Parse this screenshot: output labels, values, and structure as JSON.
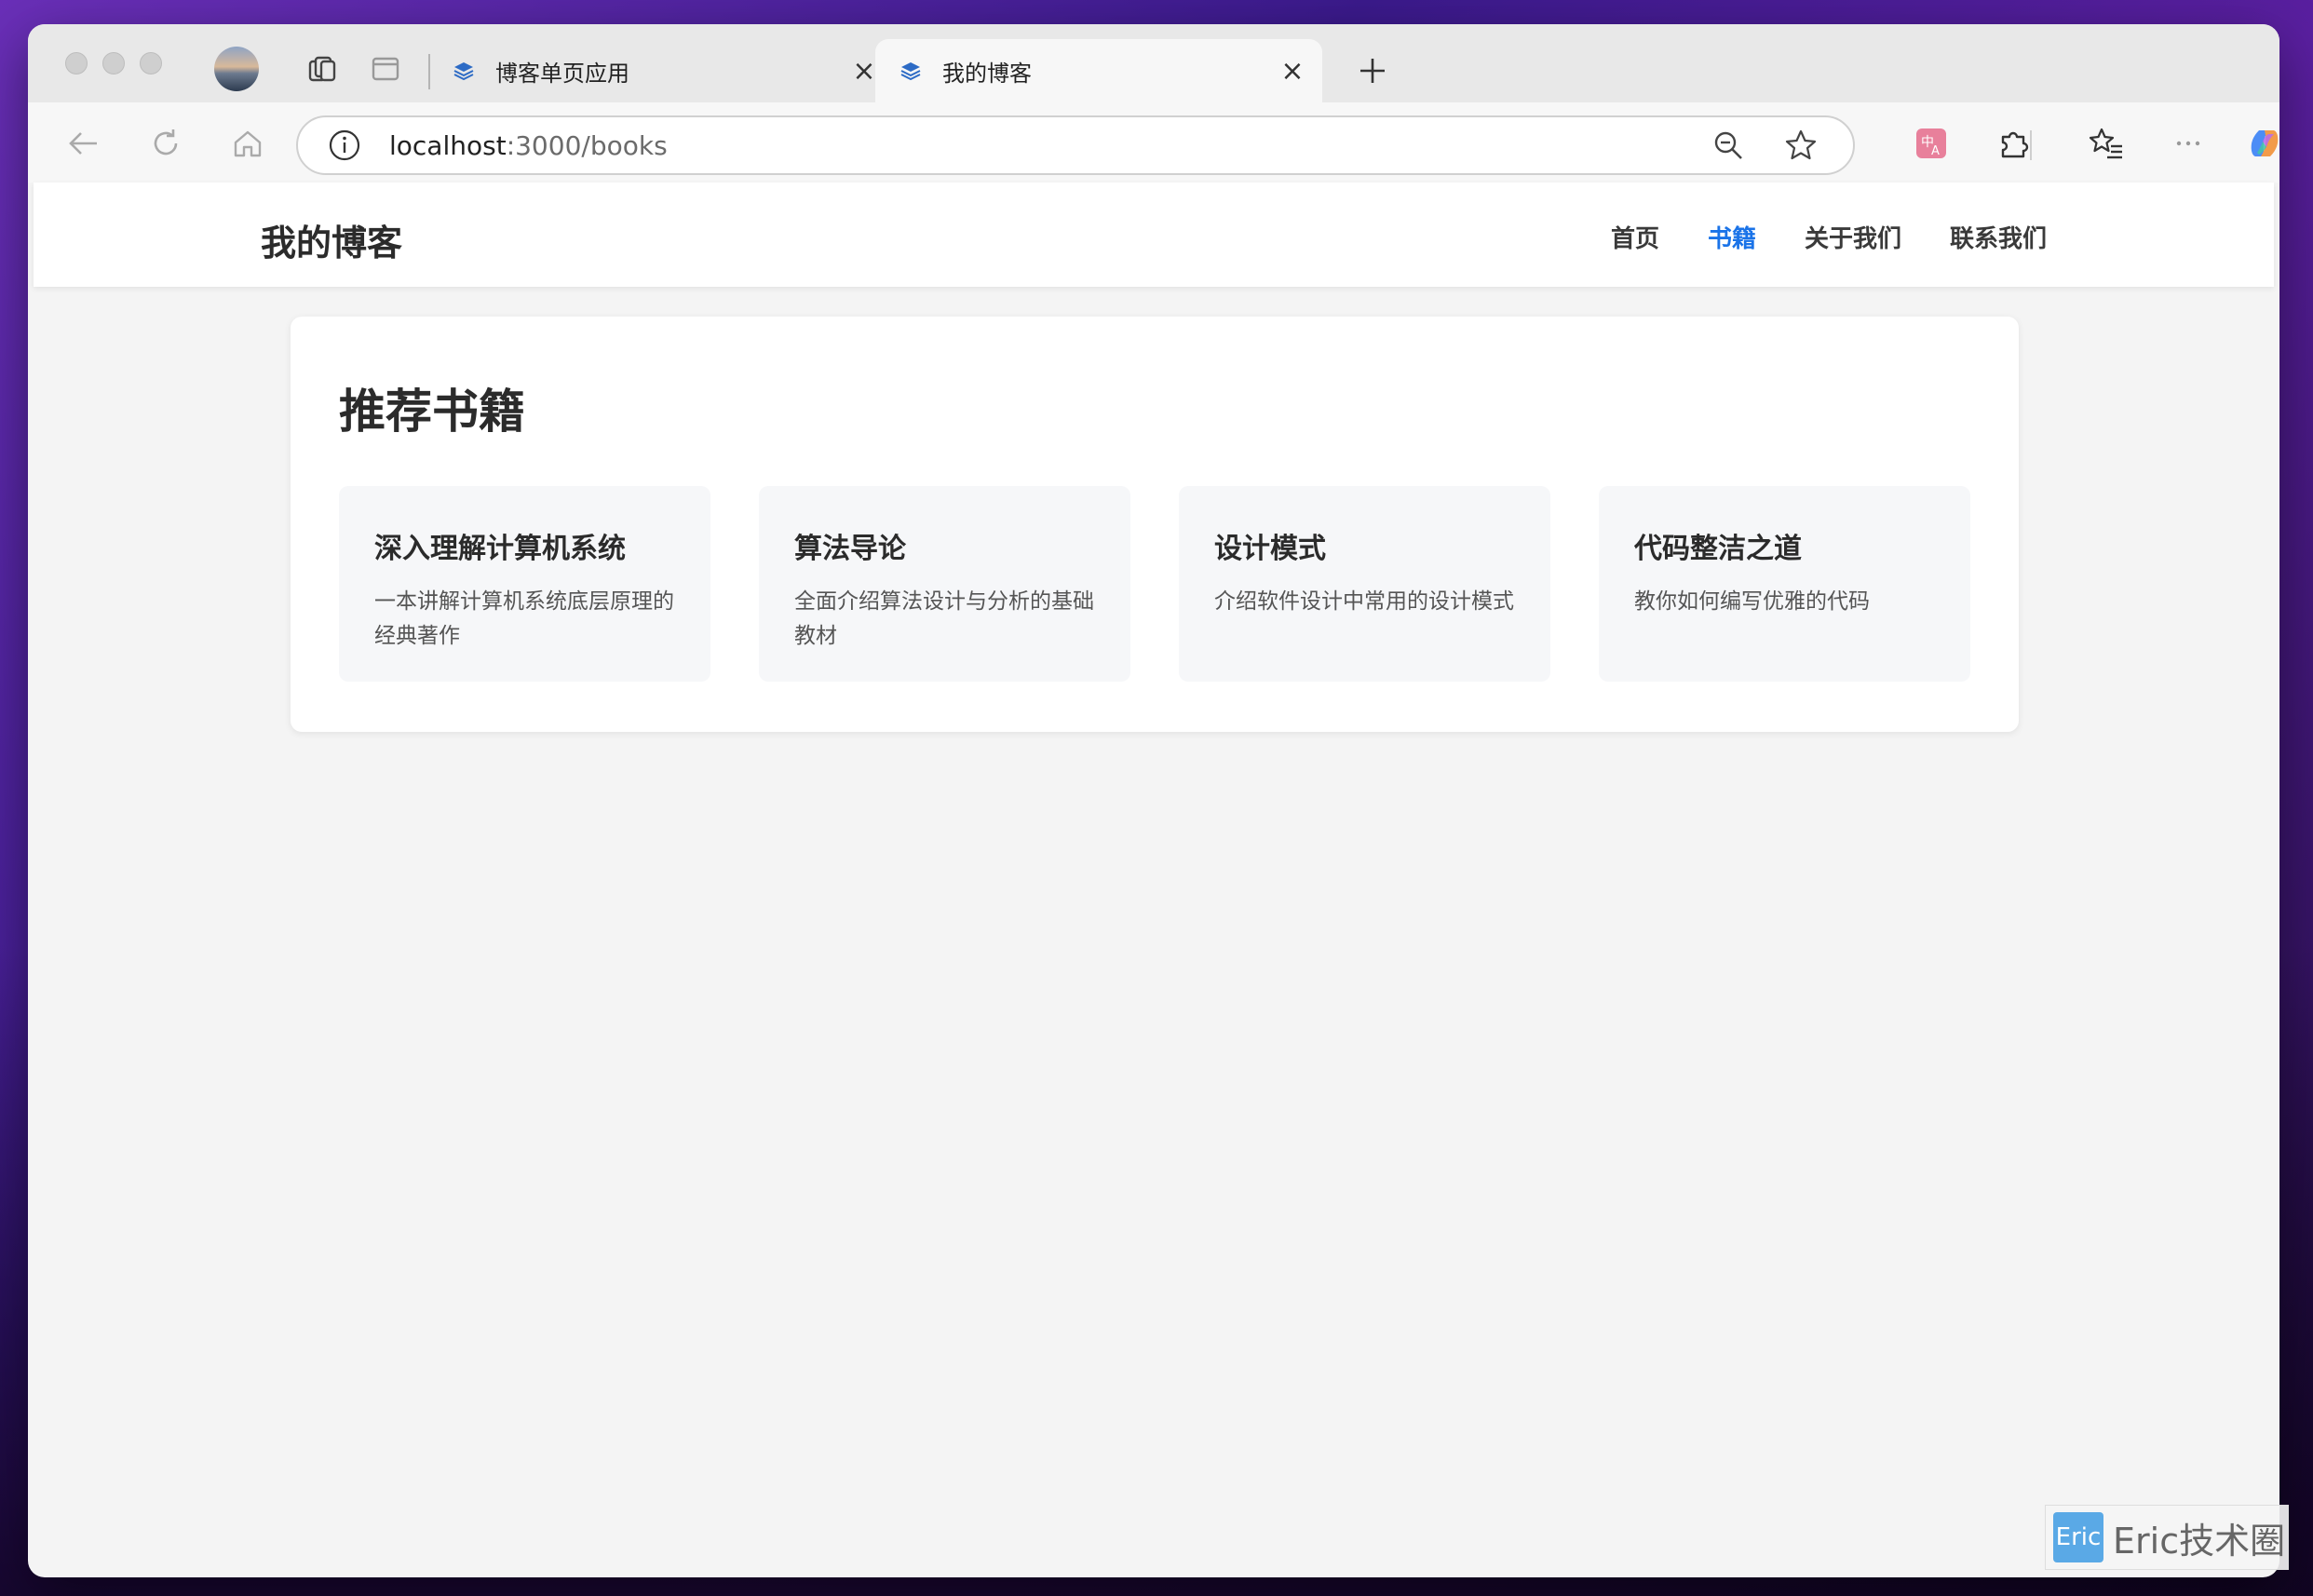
{
  "browser": {
    "tabs": [
      {
        "title": "博客单页应用",
        "active": false
      },
      {
        "title": "我的博客",
        "active": true
      }
    ],
    "url_host": "localhost",
    "url_rest": ":3000/books"
  },
  "site": {
    "logo": "我的博客",
    "nav": [
      {
        "label": "首页",
        "active": false
      },
      {
        "label": "书籍",
        "active": true
      },
      {
        "label": "关于我们",
        "active": false
      },
      {
        "label": "联系我们",
        "active": false
      }
    ],
    "accent_color": "#1a73e8"
  },
  "books_section": {
    "title": "推荐书籍",
    "books": [
      {
        "title": "深入理解计算机系统",
        "desc": "一本讲解计算机系统底层原理的经典著作"
      },
      {
        "title": "算法导论",
        "desc": "全面介绍算法设计与分析的基础教材"
      },
      {
        "title": "设计模式",
        "desc": "介绍软件设计中常用的设计模式"
      },
      {
        "title": "代码整洁之道",
        "desc": "教你如何编写优雅的代码"
      }
    ]
  },
  "watermark": {
    "badge": "Eric",
    "text": "Eric技术圈"
  }
}
